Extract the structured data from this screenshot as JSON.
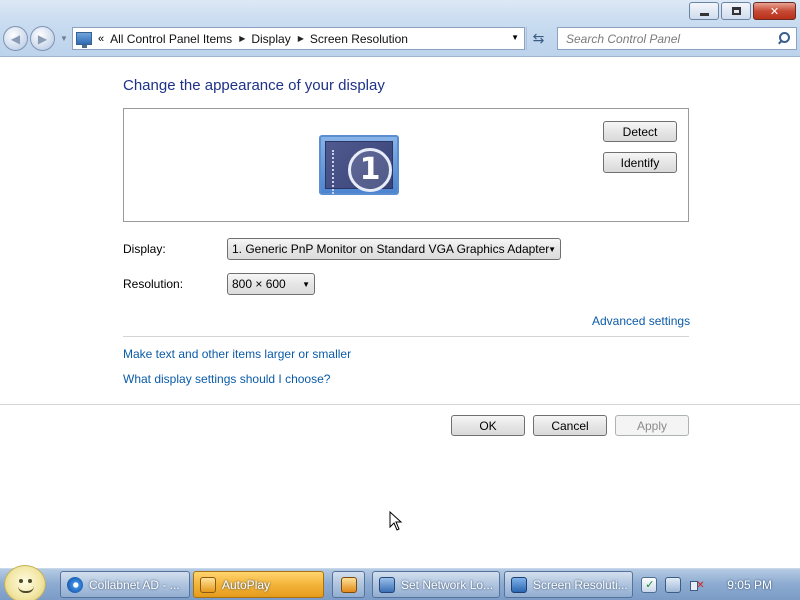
{
  "window": {
    "controls": {
      "minimize_icon": "minimize-icon",
      "maximize_icon": "restore-icon",
      "close_label": "✕"
    }
  },
  "navigation": {
    "back_icon": "back-arrow-icon",
    "forward_icon": "forward-arrow-icon",
    "address": {
      "chevrons": "«",
      "breadcrumbs": [
        "All Control Panel Items",
        "Display",
        "Screen Resolution"
      ]
    },
    "search": {
      "placeholder": "Search Control Panel"
    }
  },
  "main": {
    "title": "Change the appearance of your display",
    "monitor_number": "1",
    "detect_label": "Detect",
    "identify_label": "Identify",
    "display_label": "Display:",
    "display_value": "1. Generic PnP Monitor on Standard VGA Graphics Adapter",
    "resolution_label": "Resolution:",
    "resolution_value": "800 × 600",
    "advanced_link": "Advanced settings",
    "links": [
      "Make text and other items larger or smaller",
      "What display settings should I choose?"
    ],
    "ok_label": "OK",
    "cancel_label": "Cancel",
    "apply_label": "Apply"
  },
  "taskbar": {
    "tasks": [
      {
        "label": "Collabnet AD - ...",
        "icon": "internet-explorer-icon",
        "active": false
      },
      {
        "label": "AutoPlay",
        "icon": "autoplay-icon",
        "active": true
      },
      {
        "label": "",
        "icon": "media-player-icon",
        "active": false
      },
      {
        "label": "Set Network Lo...",
        "icon": "network-icon",
        "active": false
      },
      {
        "label": "Screen Resoluti...",
        "icon": "screen-resolution-icon",
        "active": false
      }
    ],
    "clock": "9:05 PM"
  },
  "colors": {
    "title_blue": "#1e3287",
    "link_blue": "#0b5ba8",
    "active_task": "#f3b43a"
  }
}
